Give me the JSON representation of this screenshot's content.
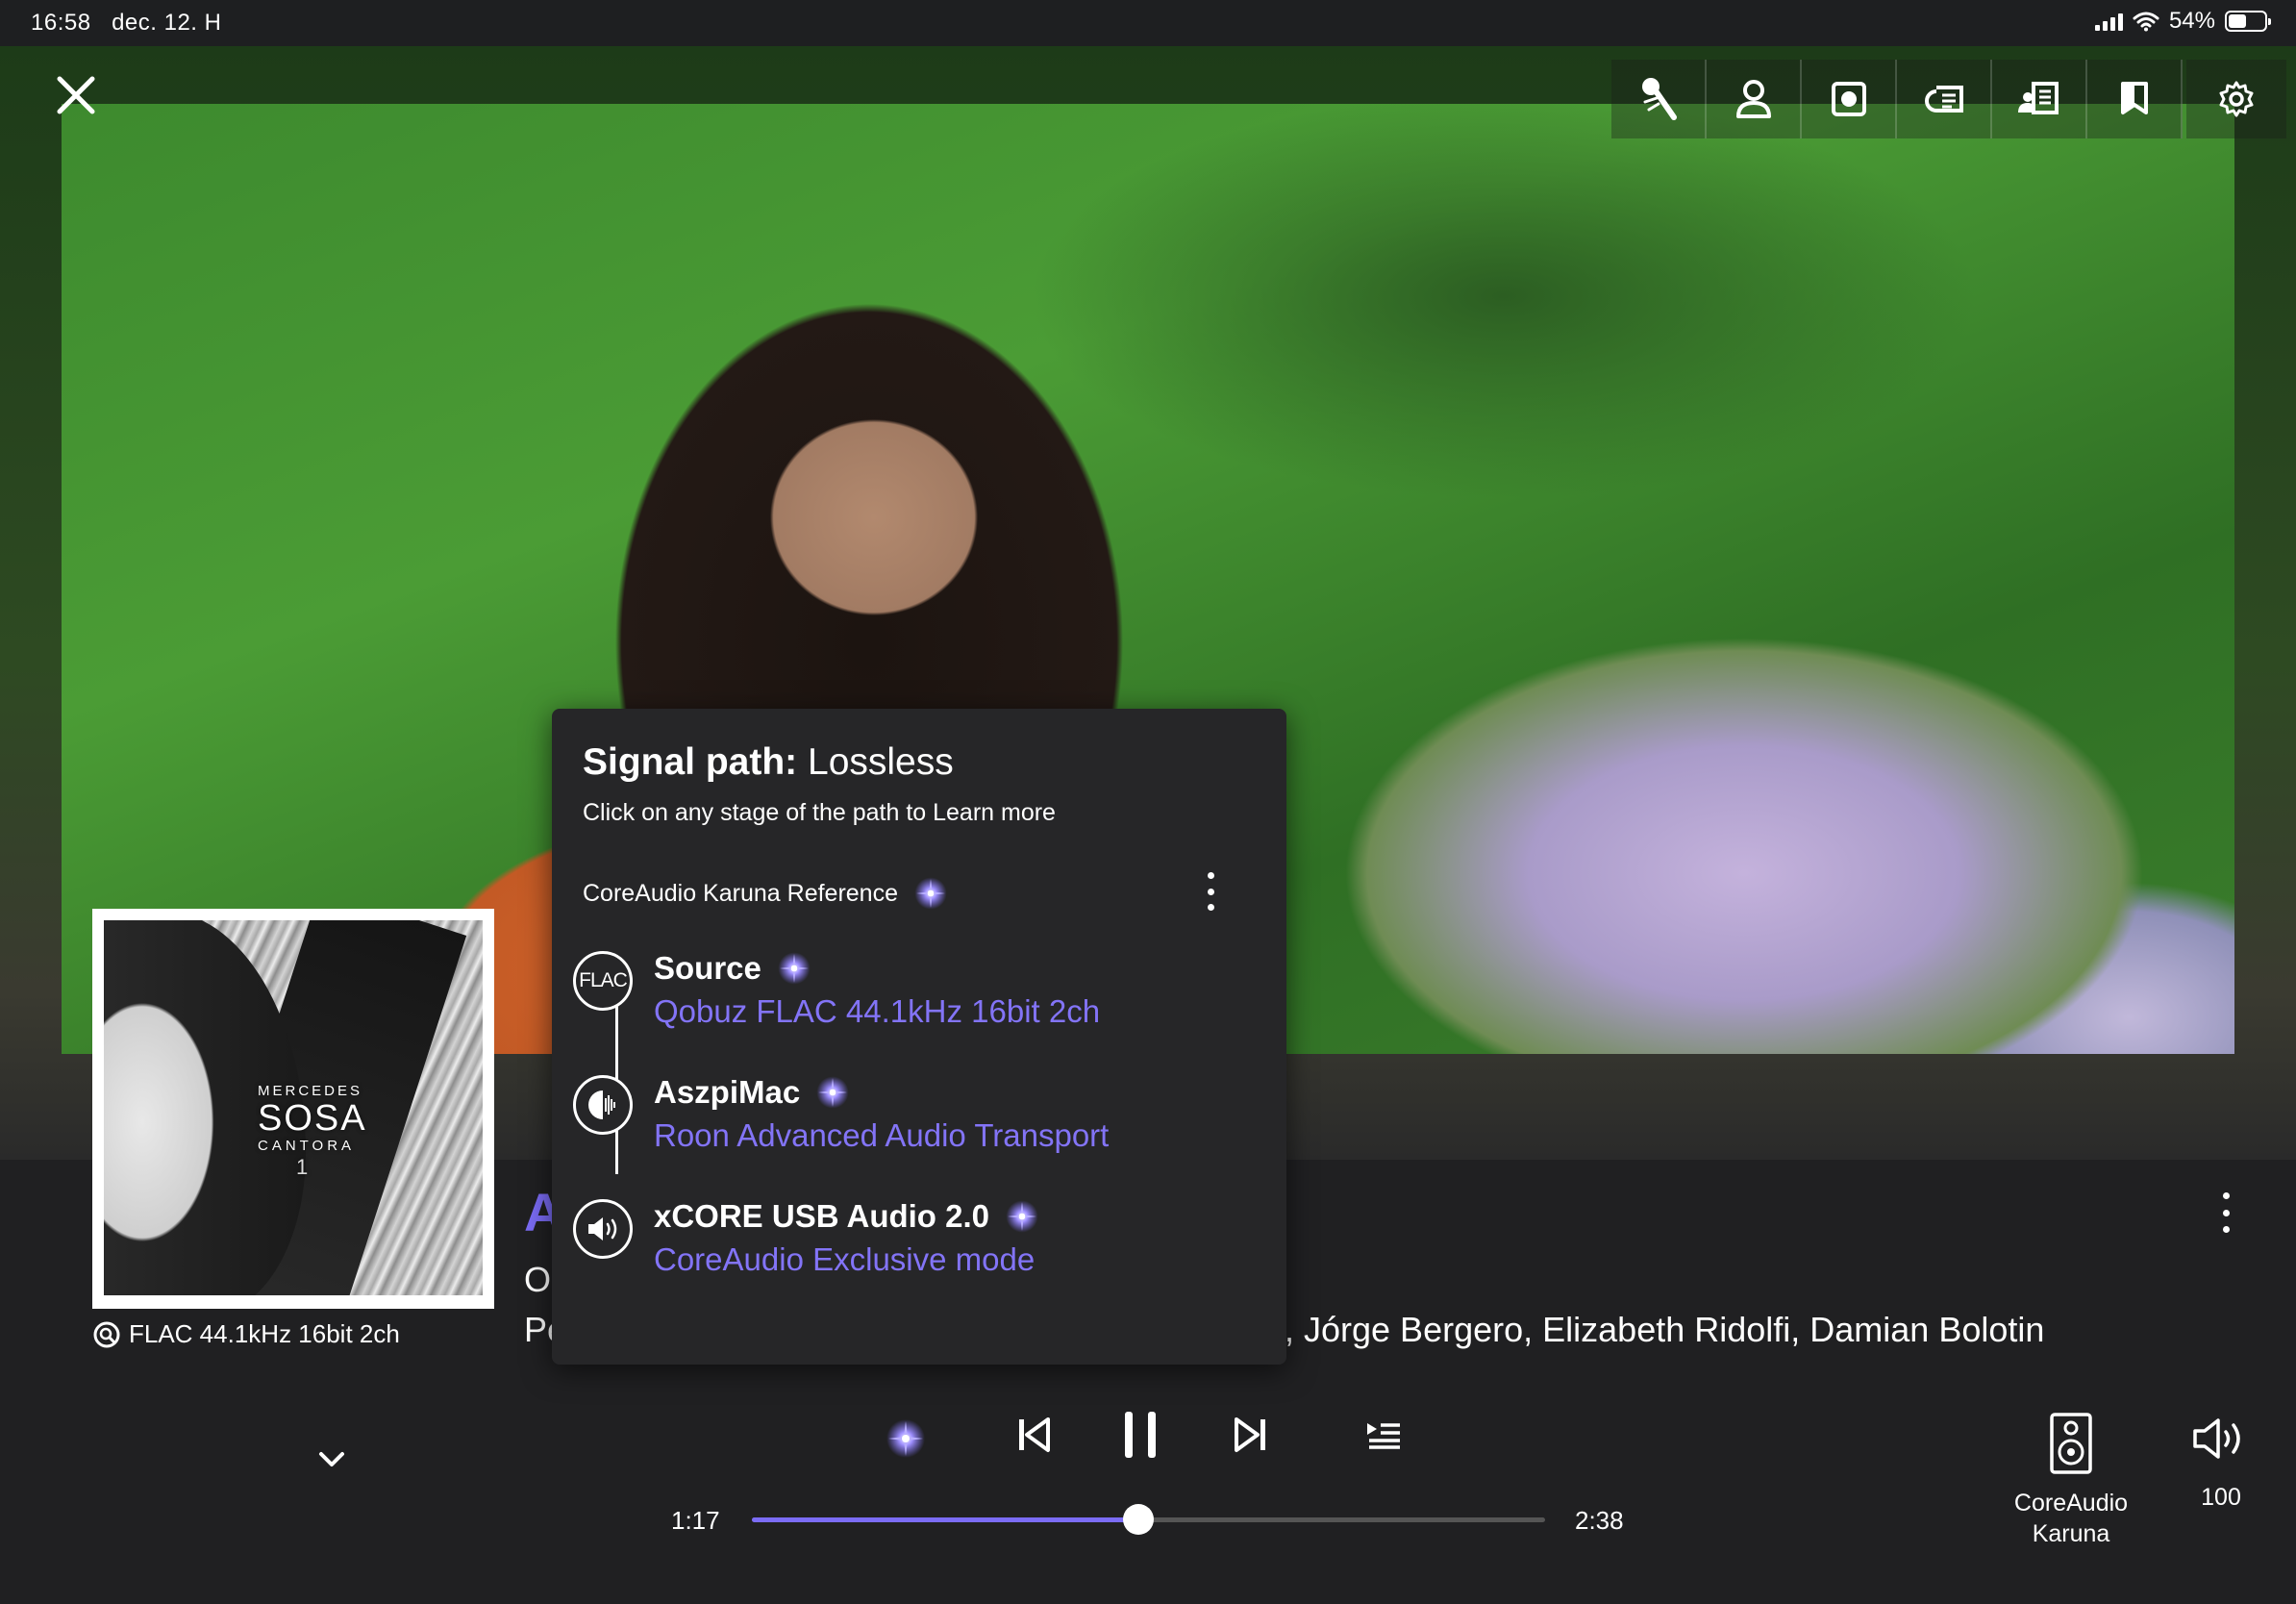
{
  "status_bar": {
    "time": "16:58",
    "date": "dec. 12. H",
    "battery": "54%",
    "battery_level": 0.54
  },
  "toolbar": {
    "icons": [
      "microphone-icon",
      "person-icon",
      "album-icon",
      "lyrics-icon",
      "credits-icon",
      "bookmark-icon",
      "settings-icon"
    ]
  },
  "now_playing": {
    "title_visible": "A",
    "line2_visible": "O",
    "line3_visible": "Pe",
    "credits": ", Jórge Bergero, Elizabeth Ridolfi, Damian Bolotin",
    "format": "FLAC 44.1kHz 16bit 2ch",
    "album_art": {
      "artist_line": "MERCEDES",
      "name_line": "SOSA",
      "album_line": "CANTORA",
      "volume_line": "1"
    }
  },
  "playback": {
    "elapsed": "1:17",
    "duration": "2:38",
    "progress": 0.487
  },
  "zone": {
    "name": "CoreAudio Karuna"
  },
  "volume": {
    "level": "100"
  },
  "signal_path": {
    "title_bold": "Signal path:",
    "title_quality": "Lossless",
    "subtitle": "Click on any stage of the path to Learn more",
    "zone_name": "CoreAudio Karuna Reference",
    "stages": [
      {
        "icon_text": "FLAC",
        "name": "Source",
        "detail": "Qobuz FLAC 44.1kHz 16bit 2ch"
      },
      {
        "icon_text": "",
        "name": "AszpiMac",
        "detail": "Roon Advanced Audio Transport"
      },
      {
        "icon_text": "",
        "name": "xCORE USB Audio 2.0",
        "detail": "CoreAudio Exclusive mode"
      }
    ]
  },
  "colors": {
    "accent": "#7b6cf6",
    "panel": "#202022",
    "popup": "#262628"
  }
}
